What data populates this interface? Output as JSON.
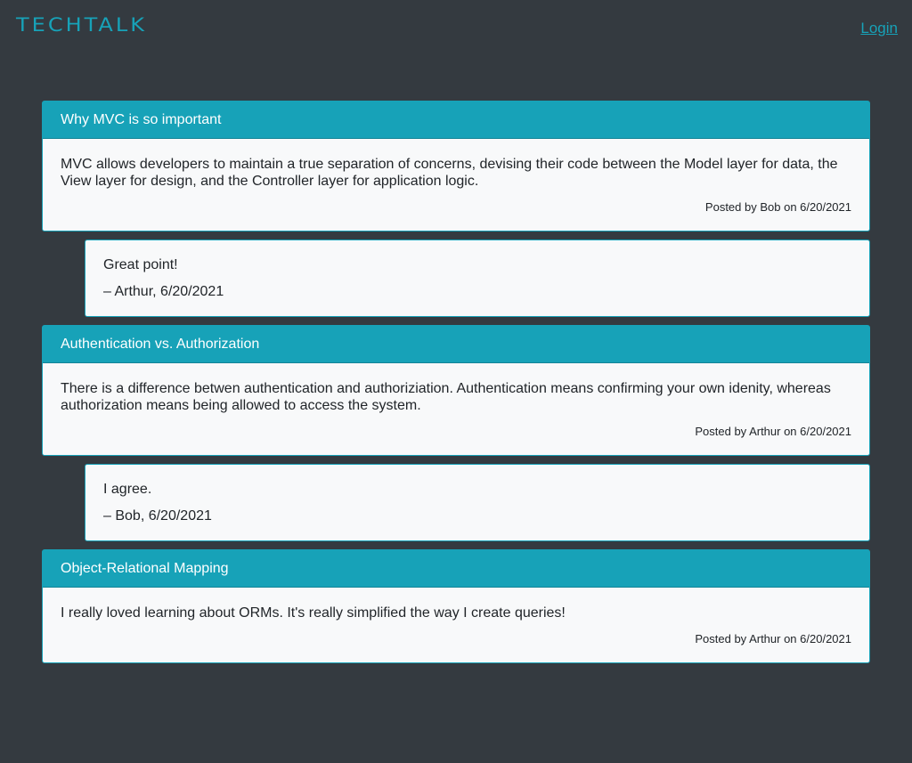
{
  "header": {
    "logo": "TECHTALK",
    "login_label": "Login"
  },
  "colors": {
    "background": "#343a40",
    "accent": "#17a2b8",
    "card": "#f8f9fa"
  },
  "posts": [
    {
      "title": "Why MVC is so important",
      "body": "MVC allows developers to maintain a true separation of concerns, devising their code between the Model layer for data, the View layer for design, and the Controller layer for application logic.",
      "meta": "Posted by Bob on 6/20/2021",
      "comment": {
        "text": "Great point!",
        "meta": "– Arthur, 6/20/2021"
      }
    },
    {
      "title": "Authentication vs. Authorization",
      "body": "There is a difference betwen authentication and authoriziation. Authentication means confirming your own idenity, whereas authorization means being allowed to access the system.",
      "meta": "Posted by Arthur on 6/20/2021",
      "comment": {
        "text": "I agree.",
        "meta": "– Bob, 6/20/2021"
      }
    },
    {
      "title": "Object-Relational Mapping",
      "body": "I really loved learning about ORMs. It's really simplified the way I create queries!",
      "meta": "Posted by Arthur on 6/20/2021"
    }
  ]
}
